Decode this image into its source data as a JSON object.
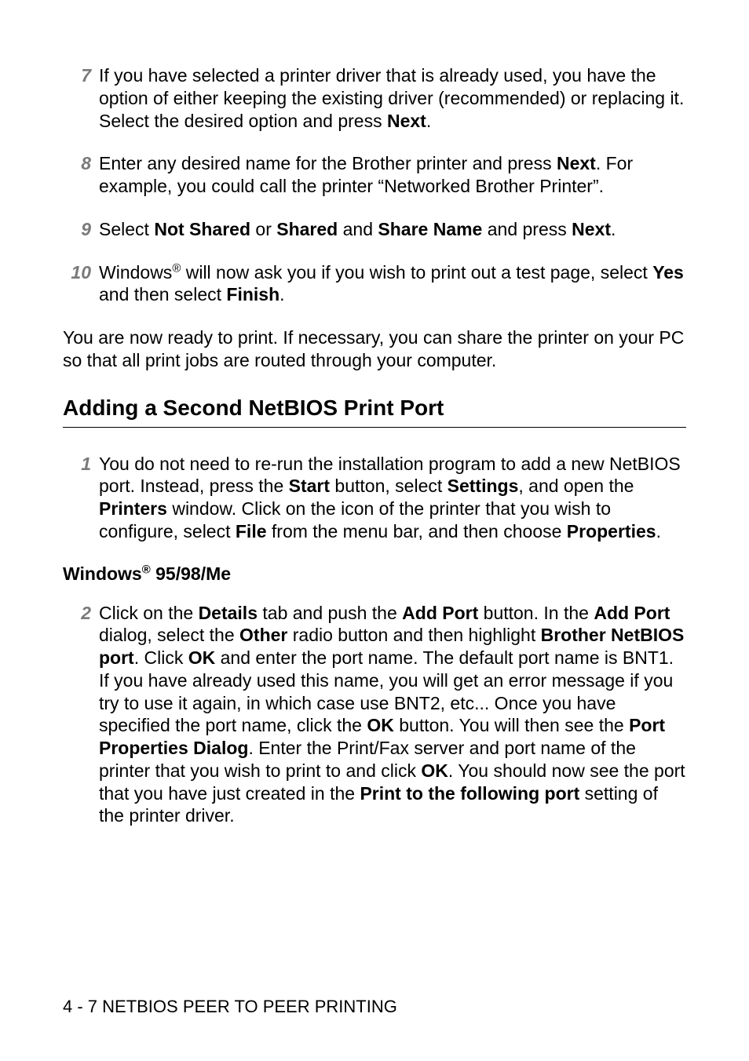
{
  "steps_a": [
    {
      "num": "7",
      "parts": [
        {
          "t": "If you have selected a printer driver that is already used, you have the option of either keeping the existing driver (recommended) or replacing it. Select the desired option and press "
        },
        {
          "t": "Next",
          "b": true
        },
        {
          "t": "."
        }
      ]
    },
    {
      "num": "8",
      "parts": [
        {
          "t": "Enter any desired name for the Brother printer and press "
        },
        {
          "t": "Next",
          "b": true
        },
        {
          "t": ". For example, you could call the printer “Networked Brother Printer”."
        }
      ]
    },
    {
      "num": "9",
      "parts": [
        {
          "t": "Select "
        },
        {
          "t": "Not Shared",
          "b": true
        },
        {
          "t": " or "
        },
        {
          "t": "Shared",
          "b": true
        },
        {
          "t": " and "
        },
        {
          "t": "Share Name",
          "b": true
        },
        {
          "t": " and press "
        },
        {
          "t": "Next",
          "b": true
        },
        {
          "t": "."
        }
      ]
    },
    {
      "num": "10",
      "parts": [
        {
          "t": "Windows"
        },
        {
          "t": "®",
          "sup": true
        },
        {
          "t": " will now ask you if you wish to print out a test page, select "
        },
        {
          "t": "Yes",
          "b": true
        },
        {
          "t": " and then select "
        },
        {
          "t": "Finish",
          "b": true
        },
        {
          "t": "."
        }
      ]
    }
  ],
  "para_ready": "You are now ready to print. If necessary, you can share the printer on your PC so that all print jobs are routed through your computer.",
  "heading": "Adding a Second NetBIOS Print Port",
  "step_b1": {
    "num": "1",
    "parts": [
      {
        "t": "You do not need to re-run the installation program to add a new NetBIOS port. Instead, press the "
      },
      {
        "t": "Start",
        "b": true
      },
      {
        "t": " button, select "
      },
      {
        "t": "Settings",
        "b": true
      },
      {
        "t": ", and open the "
      },
      {
        "t": "Printers",
        "b": true
      },
      {
        "t": " window. Click on the icon of the printer that you wish to configure, select "
      },
      {
        "t": "File",
        "b": true
      },
      {
        "t": " from the menu bar, and then choose "
      },
      {
        "t": "Properties",
        "b": true
      },
      {
        "t": "."
      }
    ]
  },
  "subheading_parts": [
    {
      "t": "Windows"
    },
    {
      "t": "®",
      "sup": true
    },
    {
      "t": " 95/98/Me"
    }
  ],
  "step_b2": {
    "num": "2",
    "parts": [
      {
        "t": "Click on the "
      },
      {
        "t": "Details",
        "b": true
      },
      {
        "t": " tab and push the "
      },
      {
        "t": "Add Port",
        "b": true
      },
      {
        "t": " button. In the "
      },
      {
        "t": "Add Port",
        "b": true
      },
      {
        "t": " dialog, select the "
      },
      {
        "t": "Other",
        "b": true
      },
      {
        "t": " radio button and then highlight "
      },
      {
        "t": "Brother NetBIOS port",
        "b": true
      },
      {
        "t": ". Click "
      },
      {
        "t": "OK",
        "b": true
      },
      {
        "t": " and enter the port name. The default port name is BNT1. If you have already used this name, you will get an error message if you try to use it again, in which case use BNT2, etc... Once you have specified the port name, click the "
      },
      {
        "t": "OK",
        "b": true
      },
      {
        "t": " button. You will then see the "
      },
      {
        "t": "Port Properties Dialog",
        "b": true
      },
      {
        "t": ". Enter the Print/Fax server and port name of the printer that you wish to print to and click "
      },
      {
        "t": "OK",
        "b": true
      },
      {
        "t": ". You should now see the port that you have just created in the "
      },
      {
        "t": "Print to the following port",
        "b": true
      },
      {
        "t": " setting of the printer driver."
      }
    ]
  },
  "footer": "4 - 7 NETBIOS PEER TO PEER PRINTING"
}
